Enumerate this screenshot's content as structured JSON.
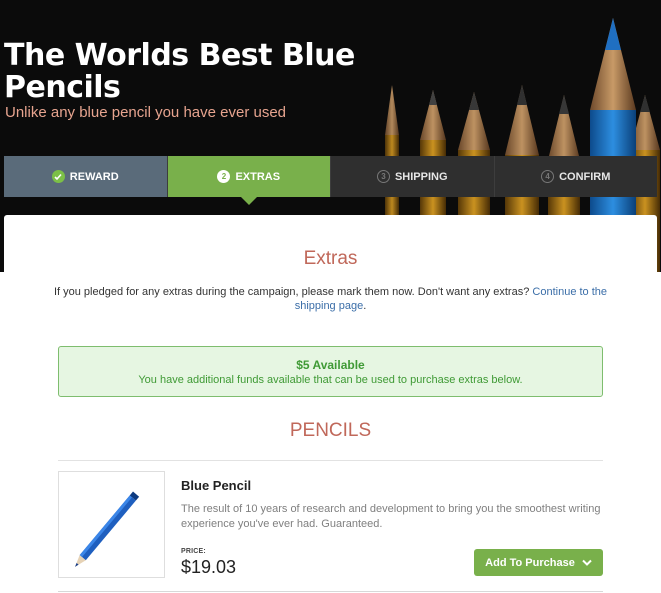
{
  "hero": {
    "title": "The Worlds Best Blue Pencils",
    "subtitle": "Unlike any blue pencil you have ever used"
  },
  "steps": [
    {
      "label": "REWARD",
      "icon": "check-icon",
      "state": "done"
    },
    {
      "label": "EXTRAS",
      "icon": "2",
      "state": "active"
    },
    {
      "label": "SHIPPING",
      "icon": "3",
      "state": "todo"
    },
    {
      "label": "CONFIRM",
      "icon": "4",
      "state": "todo"
    }
  ],
  "extras": {
    "title": "Extras",
    "intro_text": "If you pledged for any extras during the campaign, please mark them now. Don't want any extras?",
    "intro_link": "Continue to the shipping page",
    "intro_end": "."
  },
  "alert": {
    "title": "$5 Available",
    "body": "You have additional funds available that can be used to purchase extras below."
  },
  "category": {
    "title": "PENCILS"
  },
  "product": {
    "name": "Blue Pencil",
    "description": "The result of 10 years of research and development to bring you the smoothest writing experience you've ever had. Guaranteed.",
    "price_label": "PRICE:",
    "price": "$19.03",
    "add_button": "Add To Purchase",
    "image_icon": "blue-pencil-image"
  },
  "colors": {
    "accent_green": "#79b04b",
    "heading_red": "#c0685a",
    "link_blue": "#3b6ea8",
    "step_done": "#5a6b7a",
    "step_todo": "#2f2f2f"
  }
}
